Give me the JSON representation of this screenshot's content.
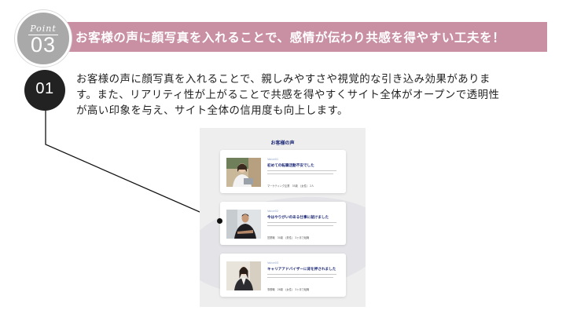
{
  "point": {
    "label": "Point",
    "number": "03"
  },
  "banner": {
    "title": "お客様の声に顔写真を入れることで、感情が伝わり共感を得やすい工夫を！"
  },
  "step": {
    "number": "01"
  },
  "description": {
    "lines": [
      "お客様の声に顔写真を入れることで、親しみやすさや視覚的な引き込み効果がありま",
      "す。また、リアリティ性が上がることで共感を得やすくサイト全体がオープンで透明性",
      "が高い印象を与え、サイト全体の信用度も向上します。"
    ]
  },
  "mock": {
    "title": "お客様の声",
    "cards": [
      {
        "voice": "Voice01",
        "headline": "初めての転職活動不安でした",
        "meta": "マーケティング企業　35歳　(女性)　2人"
      },
      {
        "voice": "Voice02",
        "headline": "今はやりがいのある仕事に就けました",
        "meta": "営業職　30歳　(男性)　3ヶ月で転職"
      },
      {
        "voice": "Voice03",
        "headline": "キャリアアドバイザーに背を押されました",
        "meta": "事務職　28歳　(女性)　3ヶ月で転職"
      }
    ]
  },
  "colors": {
    "banner": "#c98fa3",
    "badge": "#a9a9a9",
    "step": "#222222",
    "accent": "#1e2a78"
  }
}
